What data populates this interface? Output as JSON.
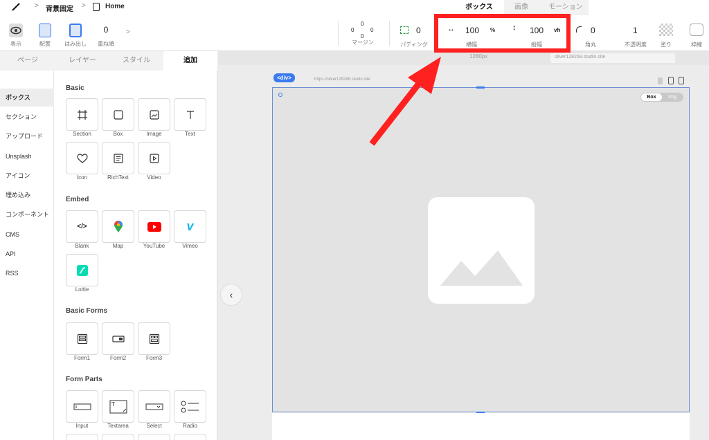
{
  "breadcrumb": {
    "project": "背景固定",
    "page": "Home"
  },
  "top_tabs": [
    "ボックス",
    "画像",
    "モーション"
  ],
  "toolbar": {
    "display": "表示",
    "placement": "配置",
    "overflow": "はみ出し",
    "zorder_value": "0",
    "zorder_label": "重ね順",
    "margin_top": "0",
    "margin_left": "0",
    "margin_right": "0",
    "margin_bottom": "0",
    "margin_label": "マージン",
    "padding_value": "0",
    "padding_label": "パディング",
    "width_value": "100",
    "width_unit": "%",
    "width_label": "横幅",
    "height_value": "100",
    "height_unit": "vh",
    "height_label": "縦幅",
    "radius_value": "0",
    "radius_label": "角丸",
    "opacity_value": "1",
    "opacity_label": "不透明度",
    "fill_label": "塗り",
    "border_label": "枠線"
  },
  "panel_tabs": [
    "ページ",
    "レイヤー",
    "スタイル",
    "追加"
  ],
  "categories": [
    "ボックス",
    "セクション",
    "アップロード",
    "Unsplash",
    "アイコン",
    "埋め込み",
    "コンポーネント",
    "CMS",
    "API",
    "RSS"
  ],
  "sections": {
    "basic": {
      "title": "Basic",
      "items": [
        "Section",
        "Box",
        "Image",
        "Text",
        "Icon",
        "RichText",
        "Video"
      ]
    },
    "embed": {
      "title": "Embed",
      "items": [
        "Blank",
        "Map",
        "YouTube",
        "Vimeo",
        "Lottie"
      ]
    },
    "basic_forms": {
      "title": "Basic Forms",
      "items": [
        "Form1",
        "Form2",
        "Form3"
      ]
    },
    "form_parts": {
      "title": "Form Parts",
      "items": [
        "Input",
        "Textarea",
        "Select",
        "Radio"
      ]
    }
  },
  "canvas": {
    "badge": "<div>",
    "url": "https://silver128268.studio.site",
    "ruler": "1280px",
    "ruler_url": "silver128268.studio.site",
    "toggle_box": "Box",
    "toggle_img": "Img"
  },
  "colors": {
    "accent": "#3a7bf0",
    "highlight": "#ff2020"
  }
}
